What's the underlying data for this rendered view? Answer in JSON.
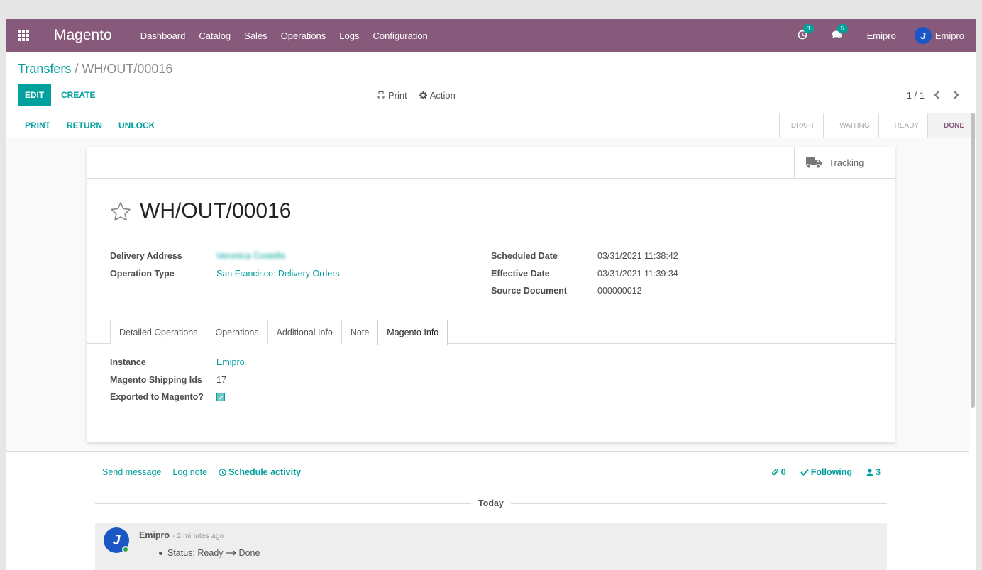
{
  "navbar": {
    "brand": "Magento",
    "menu": [
      "Dashboard",
      "Catalog",
      "Sales",
      "Operations",
      "Logs",
      "Configuration"
    ],
    "activity_count": "8",
    "message_count": "5",
    "company": "Emipro",
    "user": "Emipro",
    "user_initial": "J",
    "accent": "#875a7b"
  },
  "control_panel": {
    "breadcrumb_parent": "Transfers",
    "breadcrumb_separator": "/",
    "breadcrumb_current": "WH/OUT/00016",
    "edit_label": "EDIT",
    "create_label": "CREATE",
    "print_label": "Print",
    "action_label": "Action",
    "pager": "1 / 1"
  },
  "statusbar": {
    "buttons": [
      "PRINT",
      "RETURN",
      "UNLOCK"
    ],
    "stages": [
      "DRAFT",
      "WAITING",
      "READY",
      "DONE"
    ],
    "active_stage": "DONE"
  },
  "sheet": {
    "tracking_label": "Tracking",
    "title": "WH/OUT/00016",
    "left_fields": [
      {
        "label": "Delivery Address",
        "value": "Veronica Costello"
      },
      {
        "label": "Operation Type",
        "value": "San Francisco: Delivery Orders"
      }
    ],
    "right_fields": [
      {
        "label": "Scheduled Date",
        "value": "03/31/2021 11:38:42"
      },
      {
        "label": "Effective Date",
        "value": "03/31/2021 11:39:34"
      },
      {
        "label": "Source Document",
        "value": "000000012"
      }
    ],
    "tabs": [
      "Detailed Operations",
      "Operations",
      "Additional Info",
      "Note",
      "Magento Info"
    ],
    "active_tab": "Magento Info",
    "magento_info": [
      {
        "label": "Instance",
        "value": "Emipro"
      },
      {
        "label": "Magento Shipping Ids",
        "value": "17"
      },
      {
        "label": "Exported to Magento?",
        "value": ""
      }
    ],
    "exported_checked": true
  },
  "chatter": {
    "send_message": "Send message",
    "log_note": "Log note",
    "schedule_activity": "Schedule activity",
    "attachments": "0",
    "following": "Following",
    "followers": "3",
    "date_separator": "Today",
    "message": {
      "author": "Emipro",
      "time": "- 2 minutes ago",
      "status_label": "Status:",
      "from": "Ready",
      "to": "Done"
    }
  }
}
